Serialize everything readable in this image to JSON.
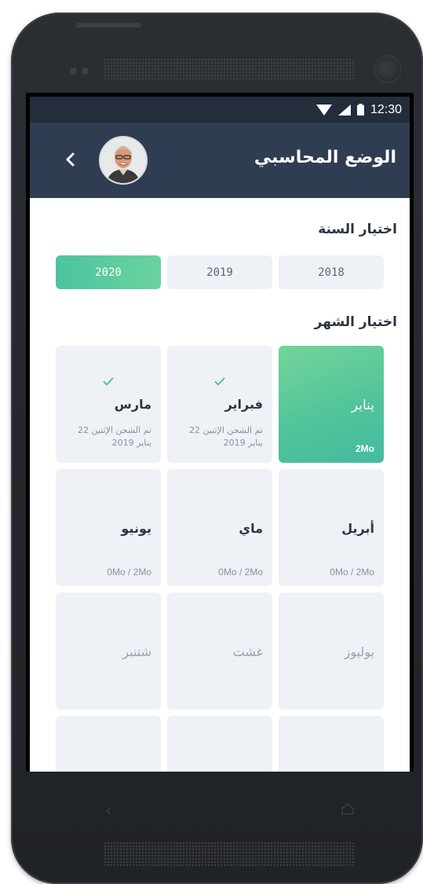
{
  "status_bar": {
    "time": "12:30",
    "icons": [
      "wifi-icon",
      "signal-icon",
      "battery-icon"
    ]
  },
  "app_bar": {
    "title": "الوضع المحاسبي",
    "back_icon": "chevron-left-icon"
  },
  "year_section": {
    "title": "اختيار السنة",
    "years": [
      {
        "label": "2020",
        "selected": true
      },
      {
        "label": "2019",
        "selected": false
      },
      {
        "label": "2018",
        "selected": false
      }
    ]
  },
  "month_section": {
    "title": "اختيار الشهر",
    "months": [
      {
        "name": "يناير",
        "quota": "2Mo",
        "selected": true
      },
      {
        "name": "فبراير",
        "note": "تم الشحن الإثنين 22 يناير 2019",
        "checked": true
      },
      {
        "name": "مارس",
        "note": "تم الشحن الإثنين 22 يناير 2019",
        "checked": true
      },
      {
        "name": "أبريل",
        "quota": "0Mo / 2Mo"
      },
      {
        "name": "ماي",
        "quota": "0Mo / 2Mo"
      },
      {
        "name": "يونيو",
        "quota": "0Mo / 2Mo"
      },
      {
        "name": "يوليوز",
        "disabled": true
      },
      {
        "name": "غشت",
        "disabled": true
      },
      {
        "name": "شتنبر",
        "disabled": true
      }
    ]
  },
  "colors": {
    "header": "#2f3d52",
    "status_bar": "#232d3b",
    "accent_gradient_start": "#4cc3a1",
    "accent_gradient_end": "#6bd39e",
    "card_bg": "#eef1f6",
    "check": "#4cc3a1"
  }
}
